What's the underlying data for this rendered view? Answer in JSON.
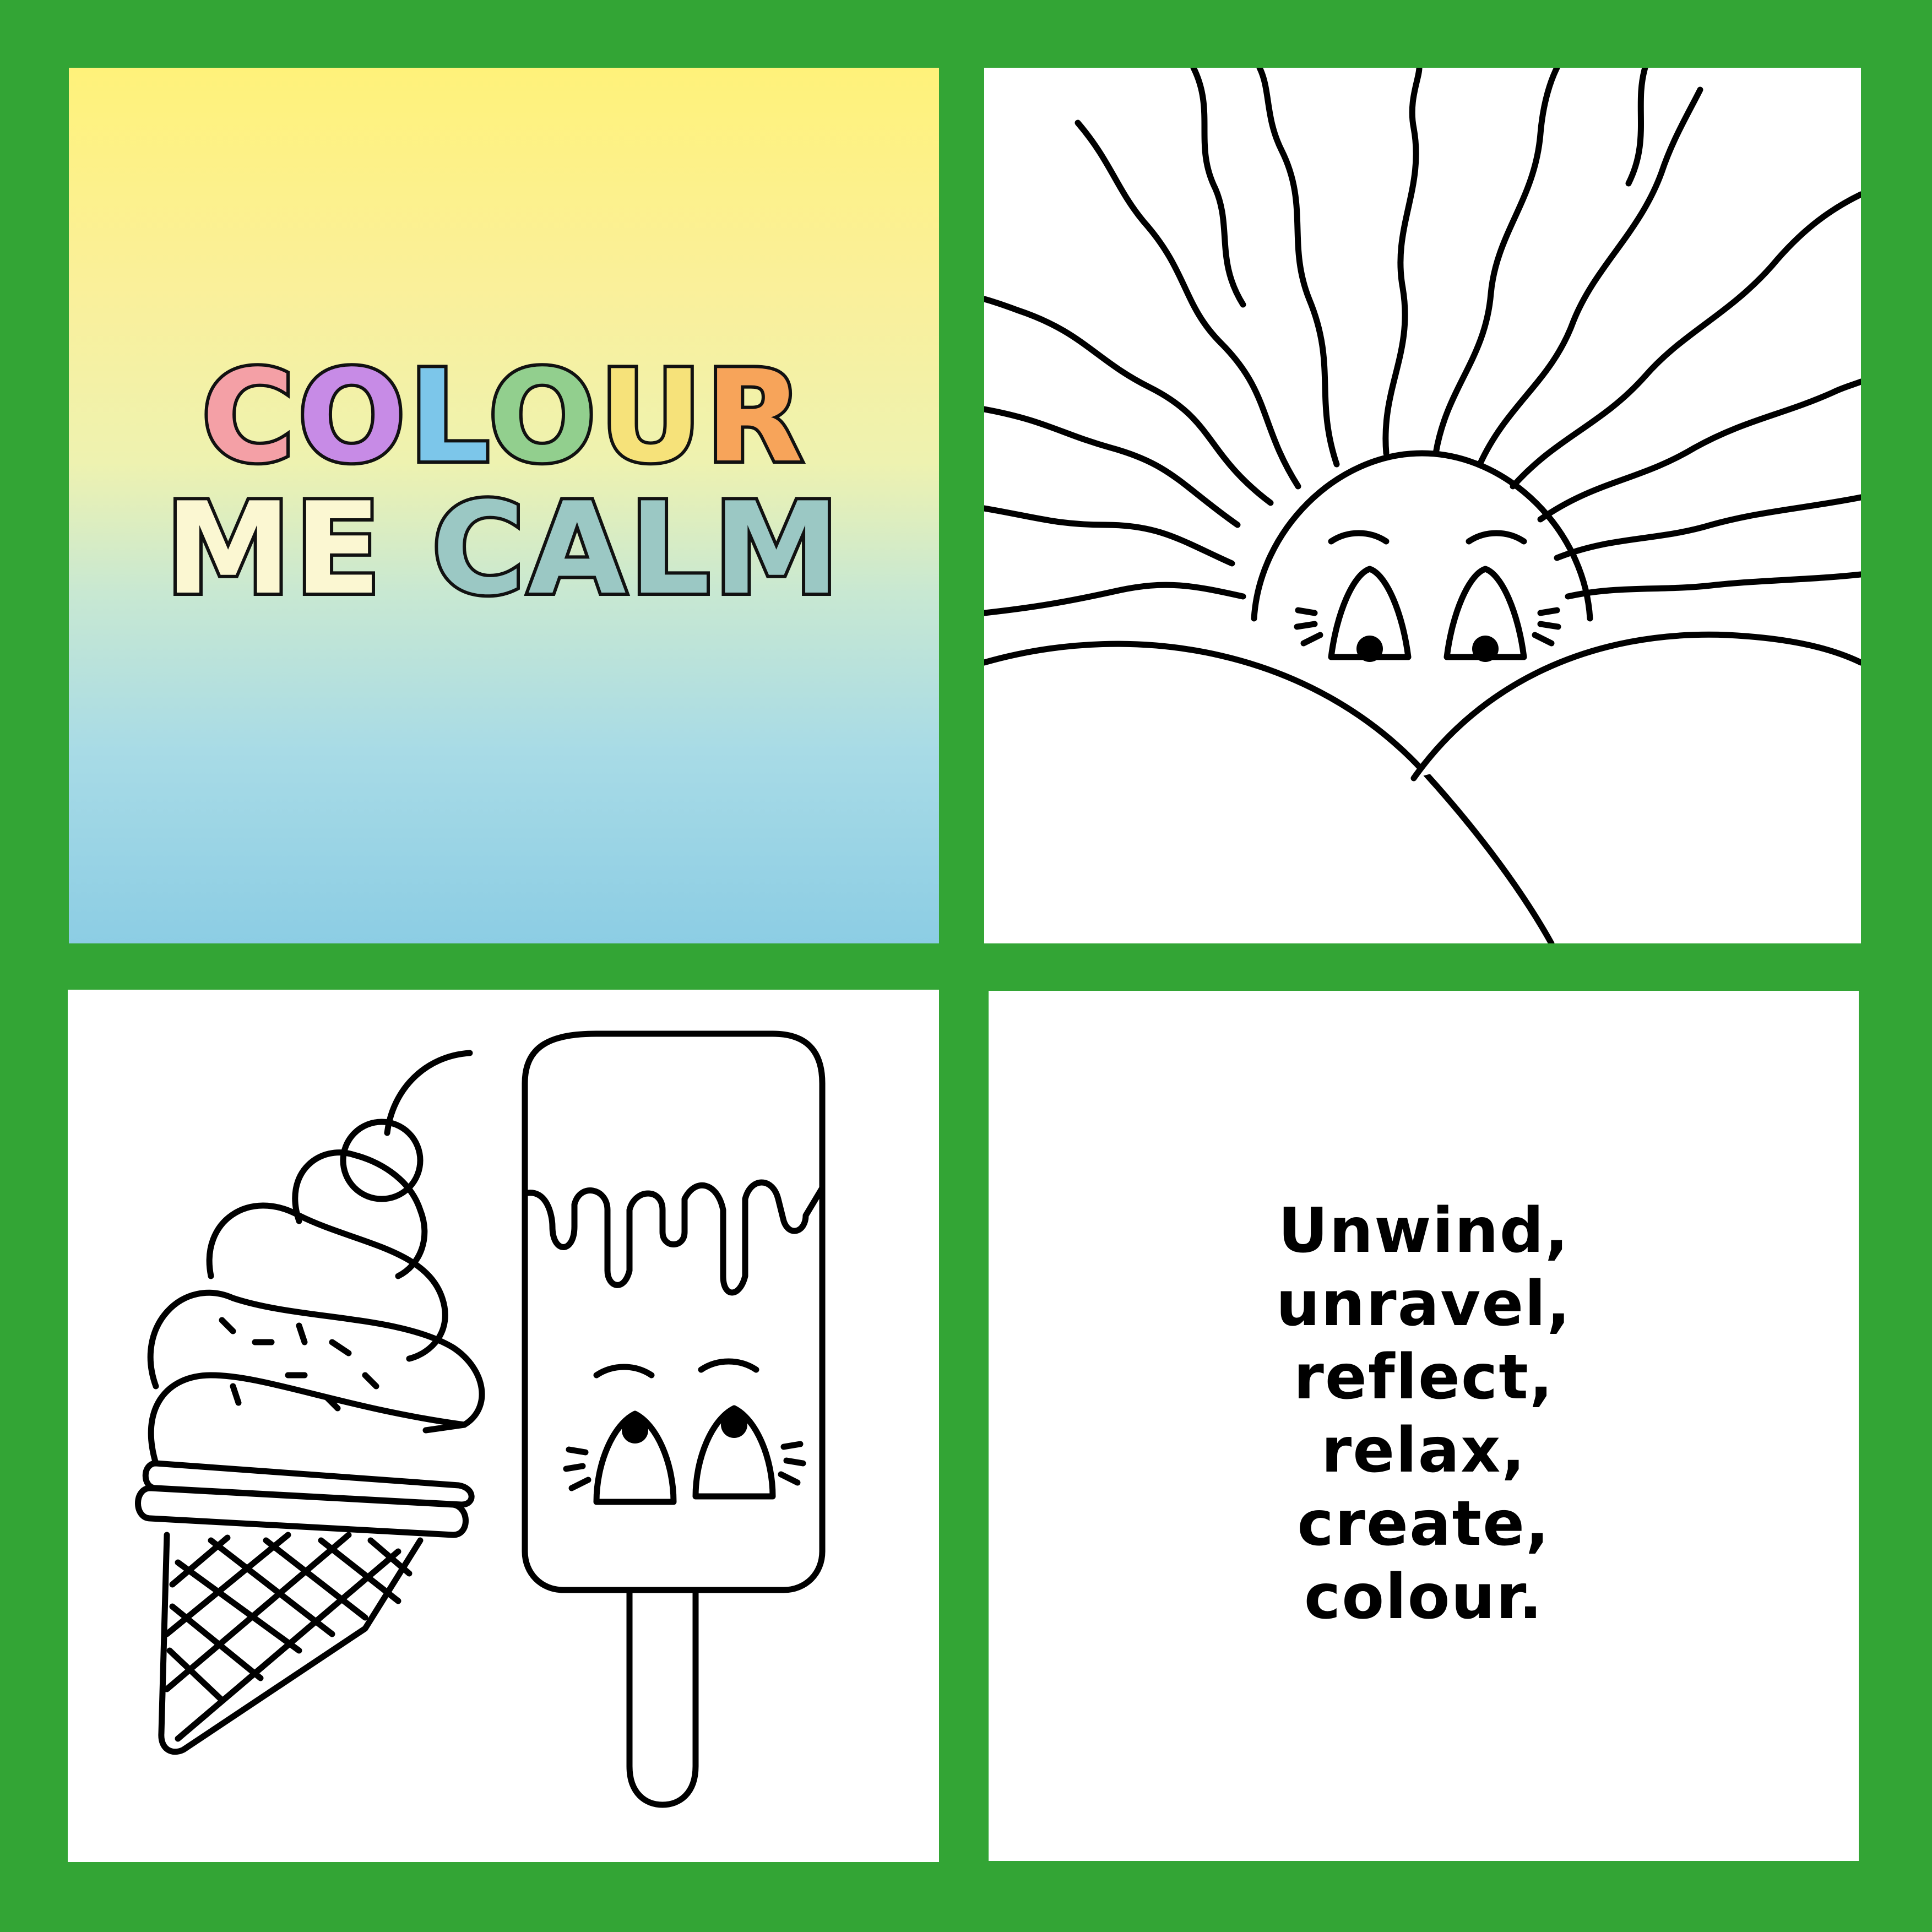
{
  "cover": {
    "title_line1_letters": [
      "C",
      "O",
      "L",
      "O",
      "U",
      "R"
    ],
    "title_line2_word1": "ME",
    "title_line2_word2": "CALM"
  },
  "words_panel": {
    "lines": [
      "Unwind,",
      "unravel,",
      "reflect,",
      "relax,",
      "create,",
      "colour."
    ]
  },
  "colors": {
    "frame": "#33a535",
    "panel_background": "#ffffff",
    "line_art": "#000000"
  },
  "icons": {
    "sun_panel": "smiling-sun-icon",
    "icecream_panel": "ice-cream-cone-and-popsicle-icon"
  }
}
